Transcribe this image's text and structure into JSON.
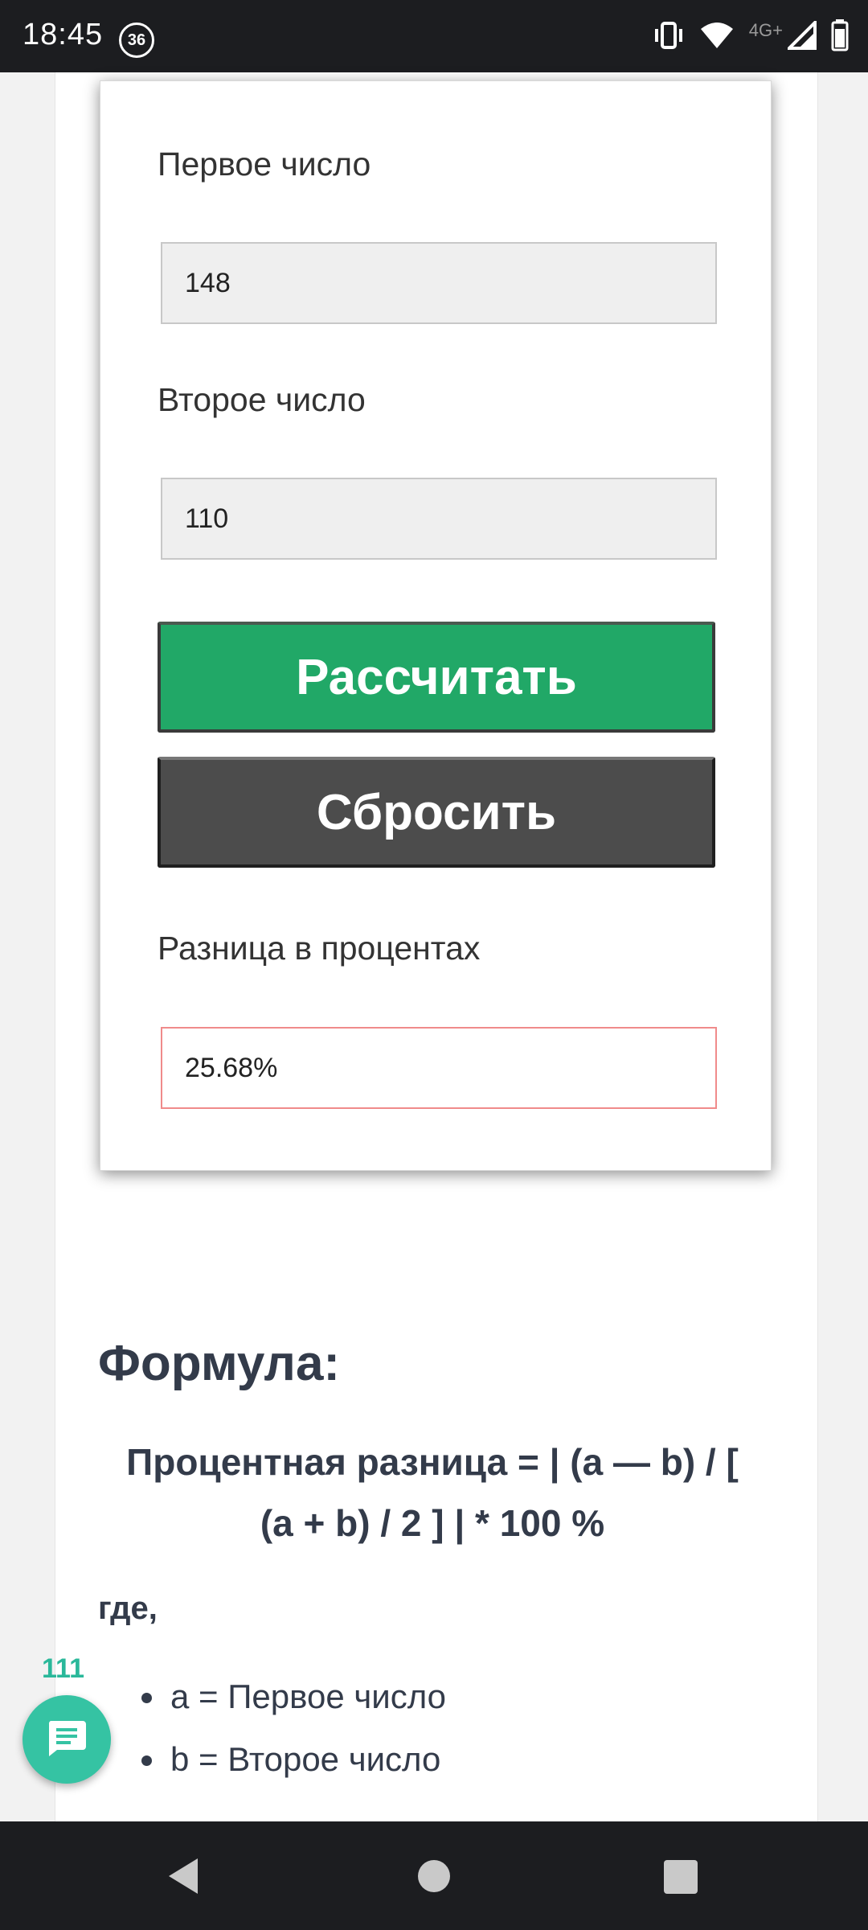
{
  "status_bar": {
    "time": "18:45",
    "badge": "36",
    "network": "4G+",
    "icons": [
      "vibrate-icon",
      "wifi-icon",
      "signal-icon",
      "battery-icon"
    ]
  },
  "calculator": {
    "first_label": "Первое число",
    "first_value": "148",
    "second_label": "Второе число",
    "second_value": "110",
    "calculate_label": "Рассчитать",
    "reset_label": "Сбросить",
    "result_label": "Разница в процентах",
    "result_value": "25.68%"
  },
  "formula": {
    "heading": "Формула:",
    "line1": "Процентная разница = | (a — b) / [",
    "line2": "(a + b) / 2 ] | * 100 %",
    "where": "где,",
    "items": [
      "a = Первое число",
      "b = Второе число"
    ]
  },
  "chat": {
    "count": "111",
    "icon": "chat-icon"
  },
  "colors": {
    "calculate_button": "#21a867",
    "reset_button": "#4c4c4c",
    "result_border": "#f08b8b",
    "chat_fab": "#35c3a3"
  }
}
